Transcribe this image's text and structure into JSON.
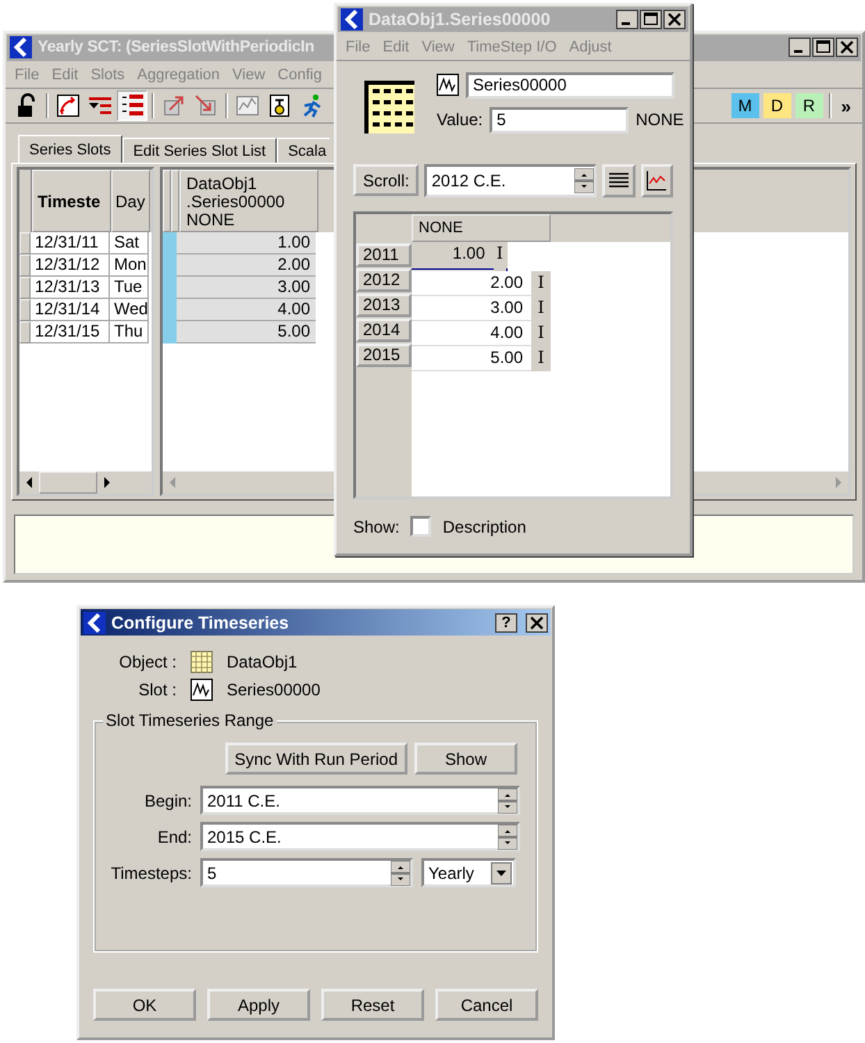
{
  "main_window": {
    "title": "Yearly SCT: (SeriesSlotWithPeriodicIn",
    "active": false,
    "menu": [
      "File",
      "Edit",
      "Slots",
      "Aggregation",
      "View",
      "Config"
    ],
    "toolbar": [
      {
        "kind": "lock",
        "pressed": false
      },
      {
        "kind": "sep"
      },
      {
        "kind": "arrows",
        "pressed": false
      },
      {
        "kind": "filter",
        "pressed": false
      },
      {
        "kind": "bars",
        "pressed": true
      },
      {
        "kind": "sep"
      },
      {
        "kind": "export",
        "pressed": false
      },
      {
        "kind": "import",
        "pressed": false
      },
      {
        "kind": "sep"
      },
      {
        "kind": "chart",
        "pressed": false
      },
      {
        "kind": "gadget",
        "pressed": false
      },
      {
        "kind": "runner",
        "pressed": false
      }
    ],
    "toolbar_badges": [
      {
        "label": "M",
        "color": "#5bc0eb"
      },
      {
        "label": "D",
        "color": "#ffe680"
      },
      {
        "label": "R",
        "color": "#b8f0b8"
      }
    ],
    "overflow": "»",
    "tabs": [
      {
        "label": "Series Slots",
        "selected": true
      },
      {
        "label": "Edit Series Slot List",
        "selected": false
      },
      {
        "label": "Scala",
        "selected": false
      }
    ],
    "left_table": {
      "columns": [
        "Timeste",
        "Day"
      ],
      "rows": [
        [
          "12/31/11",
          "Sat"
        ],
        [
          "12/31/12",
          "Mon"
        ],
        [
          "12/31/13",
          "Tue"
        ],
        [
          "12/31/14",
          "Wed"
        ],
        [
          "12/31/15",
          "Thu"
        ]
      ]
    },
    "series_column": {
      "header": "DataObj1\n.Series00000\nNONE",
      "values": [
        "1.00",
        "2.00",
        "3.00",
        "4.00",
        "5.00"
      ]
    }
  },
  "slot_window": {
    "title": "DataObj1.Series00000",
    "active": false,
    "menu": [
      "File",
      "Edit",
      "View",
      "TimeStep I/O",
      "Adjust"
    ],
    "slot_name": "Series00000",
    "value_label": "Value:",
    "value": "5",
    "unit": "NONE",
    "scroll_button": "Scroll:",
    "scroll_value": "2012 C.E.",
    "table": {
      "column": "NONE",
      "rows": [
        {
          "year": "2011",
          "value": "1.00",
          "flag": "I",
          "selected": true
        },
        {
          "year": "2012",
          "value": "2.00",
          "flag": "I",
          "selected": false
        },
        {
          "year": "2013",
          "value": "3.00",
          "flag": "I",
          "selected": false
        },
        {
          "year": "2014",
          "value": "4.00",
          "flag": "I",
          "selected": false
        },
        {
          "year": "2015",
          "value": "5.00",
          "flag": "I",
          "selected": false
        }
      ]
    },
    "show_label": "Show:",
    "description": {
      "label": "Description",
      "checked": false
    }
  },
  "dialog": {
    "title": "Configure Timeseries",
    "active": true,
    "help": "?",
    "object_label": "Object :",
    "object": "DataObj1",
    "slot_label": "Slot :",
    "slot": "Series00000",
    "group": "Slot Timeseries Range",
    "sync_button": "Sync With Run Period",
    "show_button": "Show",
    "begin_label": "Begin:",
    "begin": "2011 C.E.",
    "end_label": "End:",
    "end": "2015 C.E.",
    "timesteps_label": "Timesteps:",
    "timesteps": "5",
    "interval": "Yearly",
    "buttons": [
      "OK",
      "Apply",
      "Reset",
      "Cancel"
    ]
  }
}
